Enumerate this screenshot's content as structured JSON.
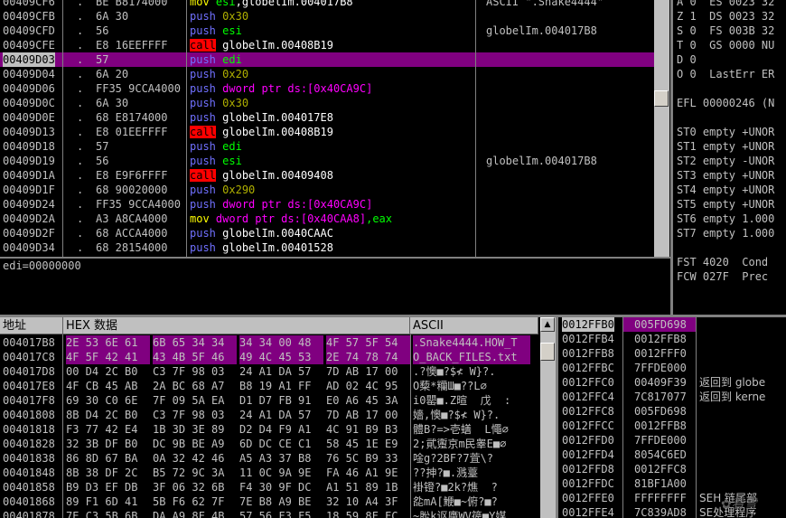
{
  "disasm": {
    "rows": [
      {
        "addr": "00409CF6",
        "dot": ".",
        "bytes": "BE B8174000",
        "mnem": "mov",
        "mtype": "mov",
        "ops": [
          {
            "t": "esi",
            "c": "reg"
          },
          {
            "t": ",globelIm.004017B8",
            "c": "plain"
          }
        ],
        "comment": "ASCII \".Snake4444\""
      },
      {
        "addr": "00409CFB",
        "dot": ".",
        "bytes": "6A 30",
        "mnem": "push",
        "mtype": "push",
        "ops": [
          {
            "t": "0x30",
            "c": "num"
          }
        ],
        "comment": ""
      },
      {
        "addr": "00409CFD",
        "dot": ".",
        "bytes": "56",
        "mnem": "push",
        "mtype": "push",
        "ops": [
          {
            "t": "esi",
            "c": "reg"
          }
        ],
        "comment": "globelIm.004017B8"
      },
      {
        "addr": "00409CFE",
        "dot": ".",
        "bytes": "E8 16EEFFFF",
        "mnem": "call",
        "mtype": "call",
        "ops": [
          {
            "t": "globelIm.00408B19",
            "c": "plain"
          }
        ],
        "comment": ""
      },
      {
        "addr": "00409D03",
        "dot": ".",
        "bytes": "57",
        "mnem": "push",
        "mtype": "push",
        "ops": [
          {
            "t": "edi",
            "c": "reg"
          }
        ],
        "comment": "",
        "selected": true
      },
      {
        "addr": "00409D04",
        "dot": ".",
        "bytes": "6A 20",
        "mnem": "push",
        "mtype": "push",
        "ops": [
          {
            "t": "0x20",
            "c": "num"
          }
        ],
        "comment": ""
      },
      {
        "addr": "00409D06",
        "dot": ".",
        "bytes": "FF35 9CCA4000",
        "mnem": "push",
        "mtype": "push",
        "ops": [
          {
            "t": "dword ptr ds:[0x40CA9C]",
            "c": "dw"
          }
        ],
        "comment": ""
      },
      {
        "addr": "00409D0C",
        "dot": ".",
        "bytes": "6A 30",
        "mnem": "push",
        "mtype": "push",
        "ops": [
          {
            "t": "0x30",
            "c": "num"
          }
        ],
        "comment": ""
      },
      {
        "addr": "00409D0E",
        "dot": ".",
        "bytes": "68 E8174000",
        "mnem": "push",
        "mtype": "push",
        "ops": [
          {
            "t": "globelIm.004017E8",
            "c": "plain"
          }
        ],
        "comment": ""
      },
      {
        "addr": "00409D13",
        "dot": ".",
        "bytes": "E8 01EEFFFF",
        "mnem": "call",
        "mtype": "call",
        "ops": [
          {
            "t": "globelIm.00408B19",
            "c": "plain"
          }
        ],
        "comment": ""
      },
      {
        "addr": "00409D18",
        "dot": ".",
        "bytes": "57",
        "mnem": "push",
        "mtype": "push",
        "ops": [
          {
            "t": "edi",
            "c": "reg"
          }
        ],
        "comment": ""
      },
      {
        "addr": "00409D19",
        "dot": ".",
        "bytes": "56",
        "mnem": "push",
        "mtype": "push",
        "ops": [
          {
            "t": "esi",
            "c": "reg"
          }
        ],
        "comment": "globelIm.004017B8"
      },
      {
        "addr": "00409D1A",
        "dot": ".",
        "bytes": "E8 E9F6FFFF",
        "mnem": "call",
        "mtype": "call",
        "ops": [
          {
            "t": "globelIm.00409408",
            "c": "plain"
          }
        ],
        "comment": ""
      },
      {
        "addr": "00409D1F",
        "dot": ".",
        "bytes": "68 90020000",
        "mnem": "push",
        "mtype": "push",
        "ops": [
          {
            "t": "0x290",
            "c": "num"
          }
        ],
        "comment": ""
      },
      {
        "addr": "00409D24",
        "dot": ".",
        "bytes": "FF35 9CCA4000",
        "mnem": "push",
        "mtype": "push",
        "ops": [
          {
            "t": "dword ptr ds:[0x40CA9C]",
            "c": "dw"
          }
        ],
        "comment": ""
      },
      {
        "addr": "00409D2A",
        "dot": ".",
        "bytes": "A3 A8CA4000",
        "mnem": "mov",
        "mtype": "mov",
        "ops": [
          {
            "t": "dword ptr ds:[0x40CAA8]",
            "c": "dw"
          },
          {
            "t": ",eax",
            "c": "reg"
          }
        ],
        "comment": ""
      },
      {
        "addr": "00409D2F",
        "dot": ".",
        "bytes": "68 ACCA4000",
        "mnem": "push",
        "mtype": "push",
        "ops": [
          {
            "t": "globelIm.0040CAAC",
            "c": "plain"
          }
        ],
        "comment": ""
      },
      {
        "addr": "00409D34",
        "dot": ".",
        "bytes": "68 28154000",
        "mnem": "push",
        "mtype": "push",
        "ops": [
          {
            "t": "globelIm.00401528",
            "c": "plain"
          }
        ],
        "comment": ""
      }
    ]
  },
  "info_pane": {
    "text": "edi=00000000"
  },
  "registers": {
    "lines": [
      "A 0  ES 0023 32",
      "Z 1  DS 0023 32",
      "S 0  FS 003B 32",
      "T 0  GS 0000 NU",
      "D 0",
      "O 0  LastErr ER",
      "",
      "EFL 00000246 (N",
      "",
      "ST0 empty +UNOR",
      "ST1 empty +UNOR",
      "ST2 empty -UNOR",
      "ST3 empty +UNOR",
      "ST4 empty +UNOR",
      "ST5 empty +UNOR",
      "ST6 empty 1.000",
      "ST7 empty 1.000",
      "",
      "FST 4020  Cond ",
      "FCW 027F  Prec "
    ]
  },
  "dump": {
    "headers": {
      "address": "地址",
      "hex": "HEX 数据",
      "ascii": "ASCII"
    },
    "rows": [
      {
        "addr": "004017B8",
        "g": [
          "2E 53 6E 61",
          "6B 65 34 34",
          "34 34 00 48",
          "4F 57 5F 54"
        ],
        "ascii": ".Snake4444.HOW_T",
        "sel": true
      },
      {
        "addr": "004017C8",
        "g": [
          "4F 5F 42 41",
          "43 4B 5F 46",
          "49 4C 45 53",
          "2E 74 78 74"
        ],
        "ascii": "O_BACK_FILES.txt",
        "sel": true
      },
      {
        "addr": "004017D8",
        "g": [
          "00 D4 2C B0",
          "C3 7F 98 03",
          "24 A1 DA 57",
          "7D AB 17 00"
        ],
        "ascii": ".?懊■?$≮ W}?."
      },
      {
        "addr": "004017E8",
        "g": [
          "4F CB 45 AB",
          "2A BC 68 A7",
          "B8 19 A1 FF",
          "AD 02 4C 95"
        ],
        "ascii": "O蔾*糷Ш■??L∅"
      },
      {
        "addr": "004017F8",
        "g": [
          "69 30 C0 6E",
          "7F 09 5A EA",
          "D1 D7 FB 91",
          "E0 A6 45 3A"
        ],
        "ascii": "i0罌■.Z暄  戊  :"
      },
      {
        "addr": "00401808",
        "g": [
          "8B D4 2C B0",
          "C3 7F 98 03",
          "24 A1 DA 57",
          "7D AB 17 00"
        ],
        "ascii": "嬙,懊■?$≮ W}?."
      },
      {
        "addr": "00401818",
        "g": [
          "F3 77 42 E4",
          "1B 3D 3E 89",
          "D2 D4 F9 A1",
          "4C 91 B9 B3"
        ],
        "ascii": "體B?=>壱蟮  L憴∅"
      },
      {
        "addr": "00401828",
        "g": [
          "32 3B DF B0",
          "DC 9B BE A9",
          "6D DC CE C1",
          "58 45 1E E9"
        ],
        "ascii": "2;貮躛京m民睾E■∅"
      },
      {
        "addr": "00401838",
        "g": [
          "86 8D 67 BA",
          "0A 32 42 46",
          "A5 A3 37 B8",
          "76 5C B9 33"
        ],
        "ascii": "唫g?2BF?7萓\\?"
      },
      {
        "addr": "00401848",
        "g": [
          "8B 38 DF 2C",
          "B5 72 9C 3A",
          "11 0C 9A 9E",
          "FA 46 A1 9E"
        ],
        "ascii": "??抻?■.溅薹"
      },
      {
        "addr": "00401858",
        "g": [
          "B9 D3 EF DB",
          "3F 06 32 6B",
          "F4 30 9F DC",
          "A1 51 89 1B"
        ],
        "ascii": "褂镫?■2k?燋  ?"
      },
      {
        "addr": "00401868",
        "g": [
          "89 F1 6D 41",
          "5B F6 62 7F",
          "7E B8 A9 BE",
          "32 10 A4 3F"
        ],
        "ascii": "夞mA[鯾■~俯?■?"
      },
      {
        "addr": "00401878",
        "g": [
          "7E C3 5B 6B",
          "DA A9 8F 4B",
          "57 56 F3 F5",
          "18 59 8F FC"
        ],
        "ascii": "~肹k讴廗WV篌■Y媒"
      }
    ]
  },
  "stack": {
    "rows": [
      {
        "addr": "0012FFB0",
        "val": "005FD698",
        "comment": "",
        "sel": true
      },
      {
        "addr": "0012FFB4",
        "val": "0012FFB8",
        "comment": ""
      },
      {
        "addr": "0012FFB8",
        "val": "0012FFF0",
        "comment": ""
      },
      {
        "addr": "0012FFBC",
        "val": "7FFDE000",
        "comment": ""
      },
      {
        "addr": "0012FFC0",
        "val": "00409F39",
        "comment": "返回到 globe"
      },
      {
        "addr": "0012FFC4",
        "val": "7C817077",
        "comment": "返回到 kerne"
      },
      {
        "addr": "0012FFC8",
        "val": "005FD698",
        "comment": ""
      },
      {
        "addr": "0012FFCC",
        "val": "0012FFB8",
        "comment": ""
      },
      {
        "addr": "0012FFD0",
        "val": "7FFDE000",
        "comment": ""
      },
      {
        "addr": "0012FFD4",
        "val": "8054C6ED",
        "comment": ""
      },
      {
        "addr": "0012FFD8",
        "val": "0012FFC8",
        "comment": ""
      },
      {
        "addr": "0012FFDC",
        "val": "81BF1A00",
        "comment": ""
      },
      {
        "addr": "0012FFE0",
        "val": "FFFFFFFF",
        "comment": "SEH 链尾部"
      },
      {
        "addr": "0012FFE4",
        "val": "7C839AD8",
        "comment": "SE处理程序"
      }
    ],
    "watermark": "看雪"
  }
}
